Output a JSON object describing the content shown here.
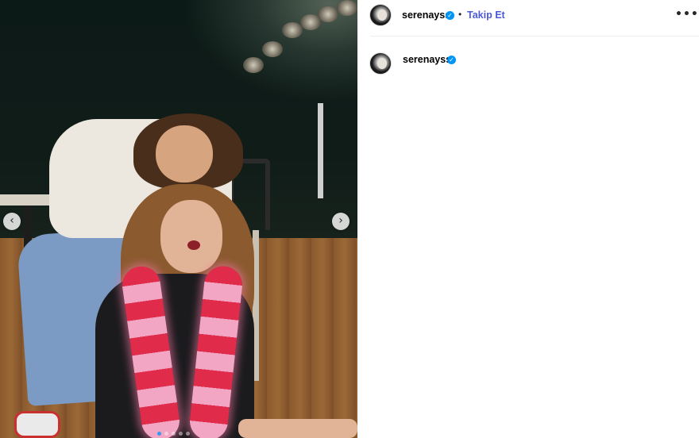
{
  "post": {
    "username": "serenayss",
    "follow_label": "Takip Et",
    "separator": "•",
    "more_label": "•••",
    "verified_mark": "✓",
    "carousel": {
      "prev_label": "‹",
      "next_label": "›",
      "slide_count": 5,
      "active_slide": 1
    }
  },
  "caption": {
    "username": "serenayss",
    "verified_mark": "✓"
  },
  "colors": {
    "follow_link": "#4c5ad6",
    "verified_badge": "#0095f6",
    "active_dot": "#3897f0"
  }
}
